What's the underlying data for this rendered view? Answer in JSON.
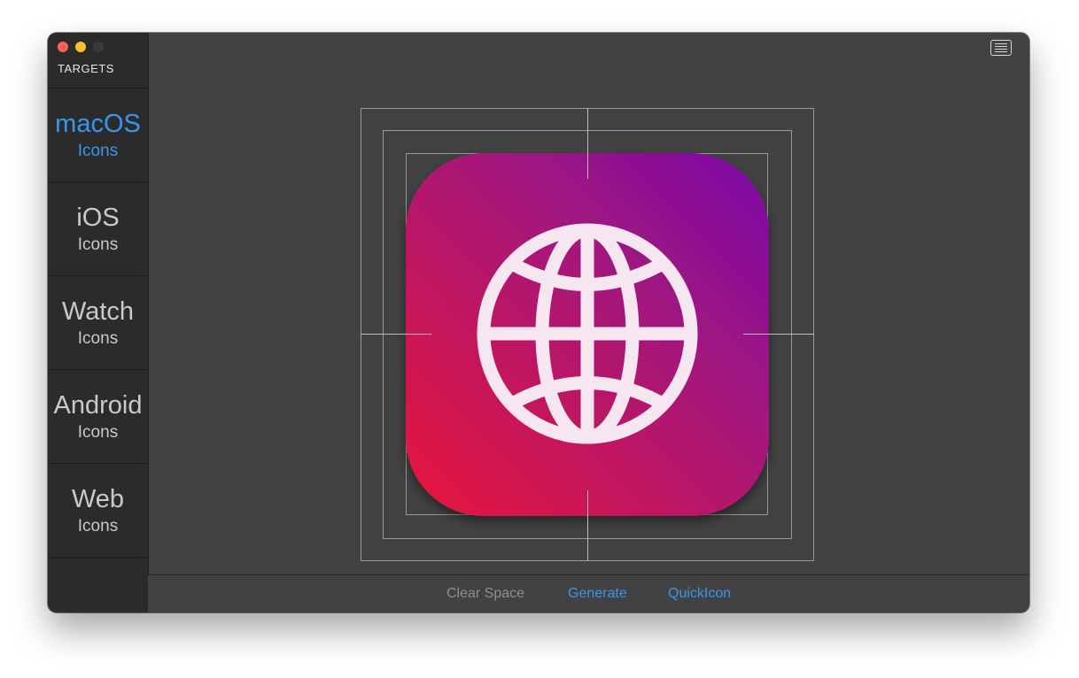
{
  "sidebar": {
    "header": "TARGETS",
    "items": [
      {
        "title": "macOS",
        "subtitle": "Icons"
      },
      {
        "title": "iOS",
        "subtitle": "Icons"
      },
      {
        "title": "Watch",
        "subtitle": "Icons"
      },
      {
        "title": "Android",
        "subtitle": "Icons"
      },
      {
        "title": "Web",
        "subtitle": "Icons"
      }
    ],
    "active_index": 0
  },
  "toolbar": {
    "menu_icon": "list-menu-icon"
  },
  "preview": {
    "icon_name": "globe-icon",
    "gradient_colors": [
      "#e8153a",
      "#b01470",
      "#7a0fa8"
    ],
    "glyph_color": "#f5e6f0",
    "guide_color": "#9a9a9a"
  },
  "bottom_bar": {
    "clear_space_label": "Clear Space",
    "generate_label": "Generate",
    "quickicon_label": "QuickIcon"
  },
  "colors": {
    "accent": "#3b95f0",
    "window_bg": "#424242",
    "sidebar_bg": "#2b2b2b"
  }
}
